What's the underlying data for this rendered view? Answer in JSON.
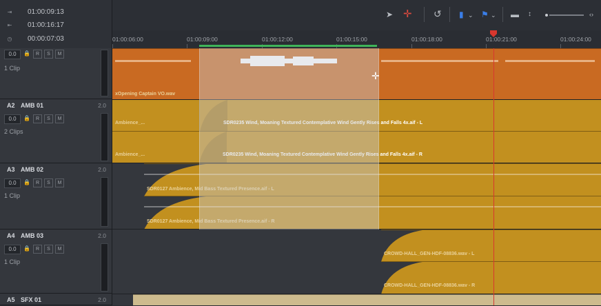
{
  "timecodes": [
    {
      "icon": "mark-in-icon",
      "glyph": "⇥",
      "value": "01:00:09:13"
    },
    {
      "icon": "mark-out-icon",
      "glyph": "⇤",
      "value": "01:00:16:17"
    },
    {
      "icon": "duration-icon",
      "glyph": "◷",
      "value": "00:00:07:03"
    }
  ],
  "toolbar": {
    "pointer": "➤",
    "range": "✛",
    "link": "↺",
    "marker": "▮",
    "flag": "⚑",
    "zoom": "▬",
    "arrows": "↕",
    "zoom_end": "‹›"
  },
  "ruler": [
    "01:00:06:00",
    "01:00:09:00",
    "01:00:12:00",
    "01:00:15:00",
    "01:00:18:00",
    "01:00:21:00",
    "01:00:24:00"
  ],
  "tracks": [
    {
      "id": "",
      "name": "",
      "level": "",
      "volume": "0.0",
      "clips": "1 Clip"
    },
    {
      "id": "A2",
      "name": "AMB 01",
      "level": "2.0",
      "volume": "0.0",
      "clips": "2 Clips"
    },
    {
      "id": "A3",
      "name": "AMB 02",
      "level": "2.0",
      "volume": "0.0",
      "clips": "1 Clip"
    },
    {
      "id": "A4",
      "name": "AMB 03",
      "level": "2.0",
      "volume": "0.0",
      "clips": "1 Clip"
    },
    {
      "id": "A5",
      "name": "SFX 01",
      "level": "2.0",
      "volume": "",
      "clips": ""
    }
  ],
  "track_buttons": {
    "r": "R",
    "s": "S",
    "m": "M",
    "lock": "🔒"
  },
  "clip_labels": {
    "vo": "xOpening Captain VO.wav",
    "amb_a": "Ambience_...",
    "wind_l": "SDR0235 Wind, Moaning Textured Contemplative Wind Gently Rises and Falls 4x.aif - L",
    "amb_b": "Ambience_...",
    "wind_r": "SDR0235 Wind, Moaning Textured Contemplative Wind Gently Rises and Falls 4x.aif - R",
    "bass_l": "SDR0127 Ambience, Mid Bass Textured Presence.aif - L",
    "bass_r": "SDR0127 Ambience, Mid Bass Textured Presence.aif - R",
    "crowd_l": "CROWD-HALL_GEN-HDF-08836.wav - L",
    "crowd_r": "CROWD-HALL_GEN-HDF-08836.wav - R"
  },
  "colors": {
    "vo": "#c96a22",
    "amb": "#c2901f",
    "ambdark": "#a77a19",
    "playhead": "#d8372e",
    "range": "#3fb559"
  }
}
